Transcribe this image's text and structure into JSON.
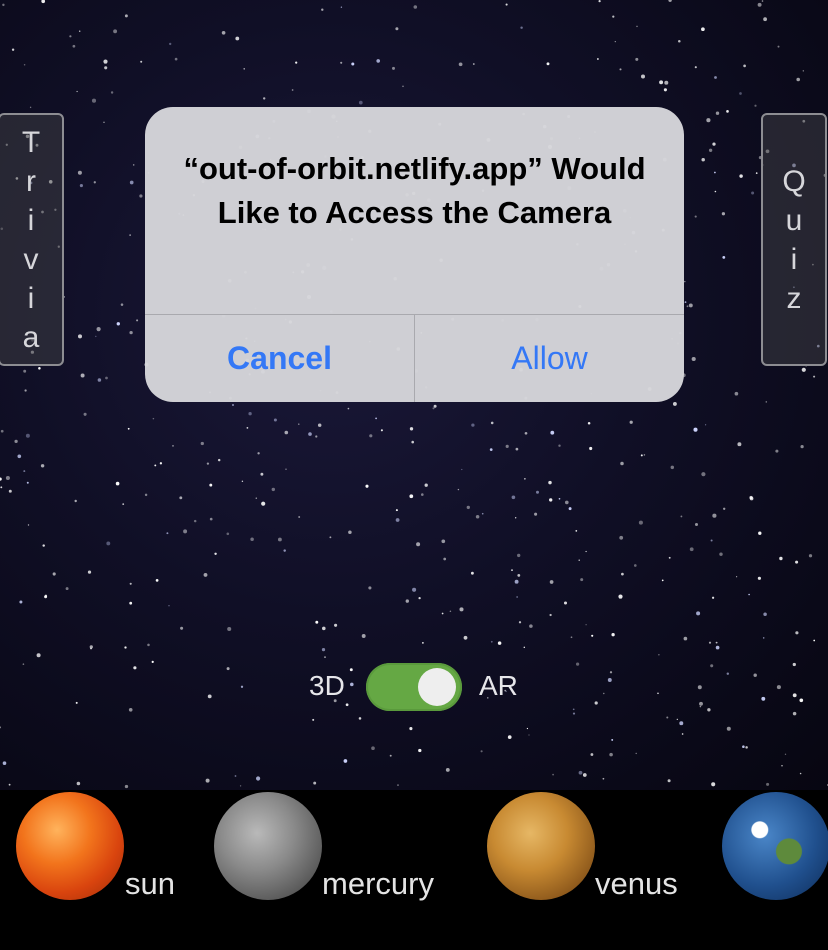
{
  "side_tabs": {
    "trivia": [
      "T",
      "r",
      "i",
      "v",
      "i",
      "a"
    ],
    "quiz": [
      "Q",
      "u",
      "i",
      "z"
    ]
  },
  "dialog": {
    "title": "“out-of-orbit.netlify.app” Would Like to Access the Camera",
    "cancel_label": "Cancel",
    "allow_label": "Allow"
  },
  "mode_toggle": {
    "left_label": "3D",
    "right_label": "AR",
    "state": "AR",
    "on_color": "#65a844"
  },
  "planets": [
    {
      "name": "sun"
    },
    {
      "name": "mercury"
    },
    {
      "name": "venus"
    },
    {
      "name": "earth"
    }
  ],
  "colors": {
    "dialog_button": "#3478f6",
    "background": "#0b0a1c"
  }
}
